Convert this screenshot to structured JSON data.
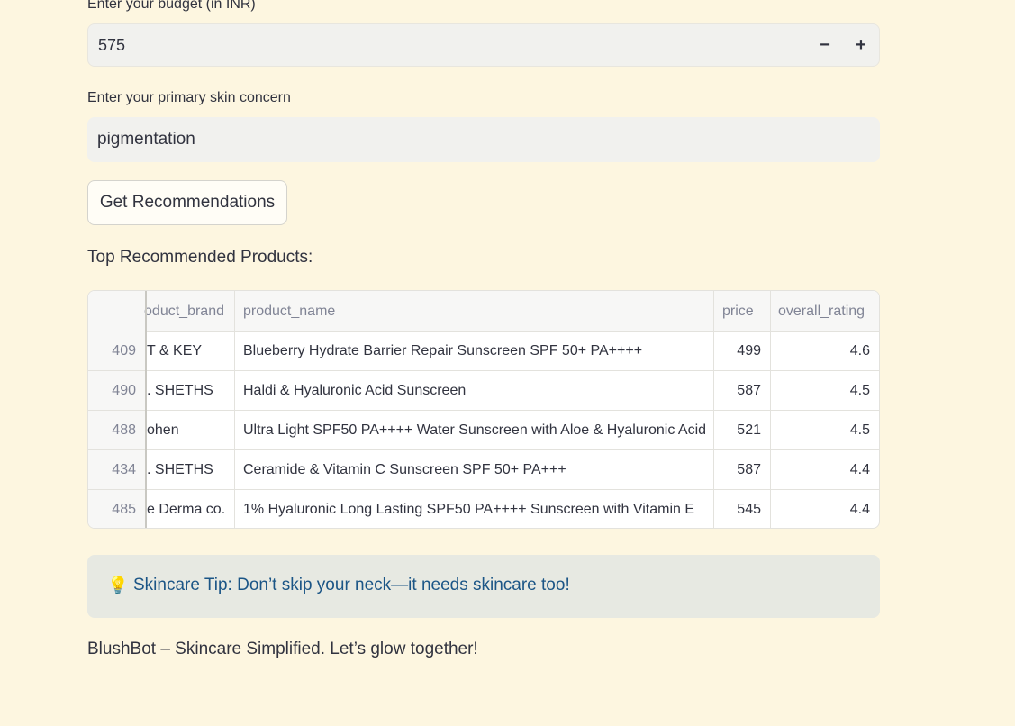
{
  "budget": {
    "label": "Enter your budget (in INR)",
    "value": "575",
    "minus": "−",
    "plus": "+"
  },
  "concern": {
    "label": "Enter your primary skin concern",
    "value": "pigmentation"
  },
  "button": {
    "label": "Get Recommendations"
  },
  "results": {
    "heading": "Top Recommended Products:",
    "columns": [
      "",
      "oduct_brand",
      "product_name",
      "price",
      "overall_rating"
    ],
    "rows": [
      {
        "index": "409",
        "brand": "T & KEY",
        "name": "Blueberry Hydrate Barrier Repair Sunscreen SPF 50+ PA++++",
        "price": "499",
        "rating": "4.6"
      },
      {
        "index": "490",
        "brand": ". SHETHS",
        "name": "Haldi & Hyaluronic Acid Sunscreen",
        "price": "587",
        "rating": "4.5"
      },
      {
        "index": "488",
        "brand": "ohen",
        "name": "Ultra Light SPF50 PA++++ Water Sunscreen with Aloe & Hyaluronic Acid",
        "price": "521",
        "rating": "4.5"
      },
      {
        "index": "434",
        "brand": ". SHETHS",
        "name": "Ceramide & Vitamin C Sunscreen SPF 50+ PA+++",
        "price": "587",
        "rating": "4.4"
      },
      {
        "index": "485",
        "brand": "e Derma co.",
        "name": "1% Hyaluronic Long Lasting SPF50 PA++++ Sunscreen with Vitamin E",
        "price": "545",
        "rating": "4.4"
      }
    ]
  },
  "tip": {
    "icon": "lightbulb-icon",
    "text": "Skincare Tip: Don’t skip your neck—it needs skincare too!"
  },
  "footer": {
    "text": "BlushBot – Skincare Simplified. Let’s glow together!"
  }
}
